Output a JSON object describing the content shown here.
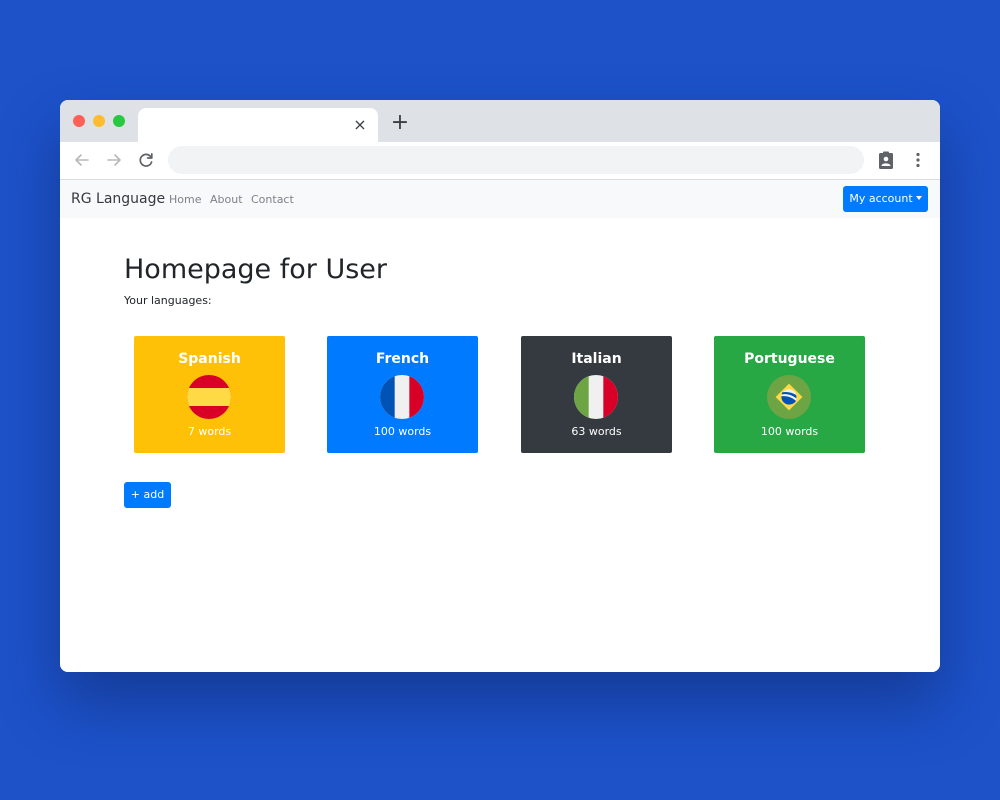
{
  "browser": {
    "tab_close": "×",
    "new_tab": "+",
    "back_icon": "arrow-left-icon",
    "forward_icon": "arrow-right-icon",
    "reload_icon": "reload-icon",
    "extension_icon": "clipboard-person-icon",
    "menu_icon": "kebab-menu-icon"
  },
  "navbar": {
    "brand": "RG Language",
    "links": [
      "Home",
      "About",
      "Contact"
    ],
    "account_label": "My account"
  },
  "main": {
    "title": "Homepage for User",
    "subtitle": "Your languages:",
    "languages": [
      {
        "name": "Spanish",
        "words": "7 words",
        "color": "#ffc107",
        "flag": "spain-flag-icon"
      },
      {
        "name": "French",
        "words": "100 words",
        "color": "#007bff",
        "flag": "france-flag-icon"
      },
      {
        "name": "Italian",
        "words": "63 words",
        "color": "#343a40",
        "flag": "italy-flag-icon"
      },
      {
        "name": "Portuguese",
        "words": "100 words",
        "color": "#28a745",
        "flag": "brazil-flag-icon"
      }
    ],
    "add_label": "+ add"
  },
  "colors": {
    "background": "#1d52c9",
    "primary": "#007bff",
    "warning": "#ffc107",
    "dark": "#343a40",
    "success": "#28a745"
  }
}
